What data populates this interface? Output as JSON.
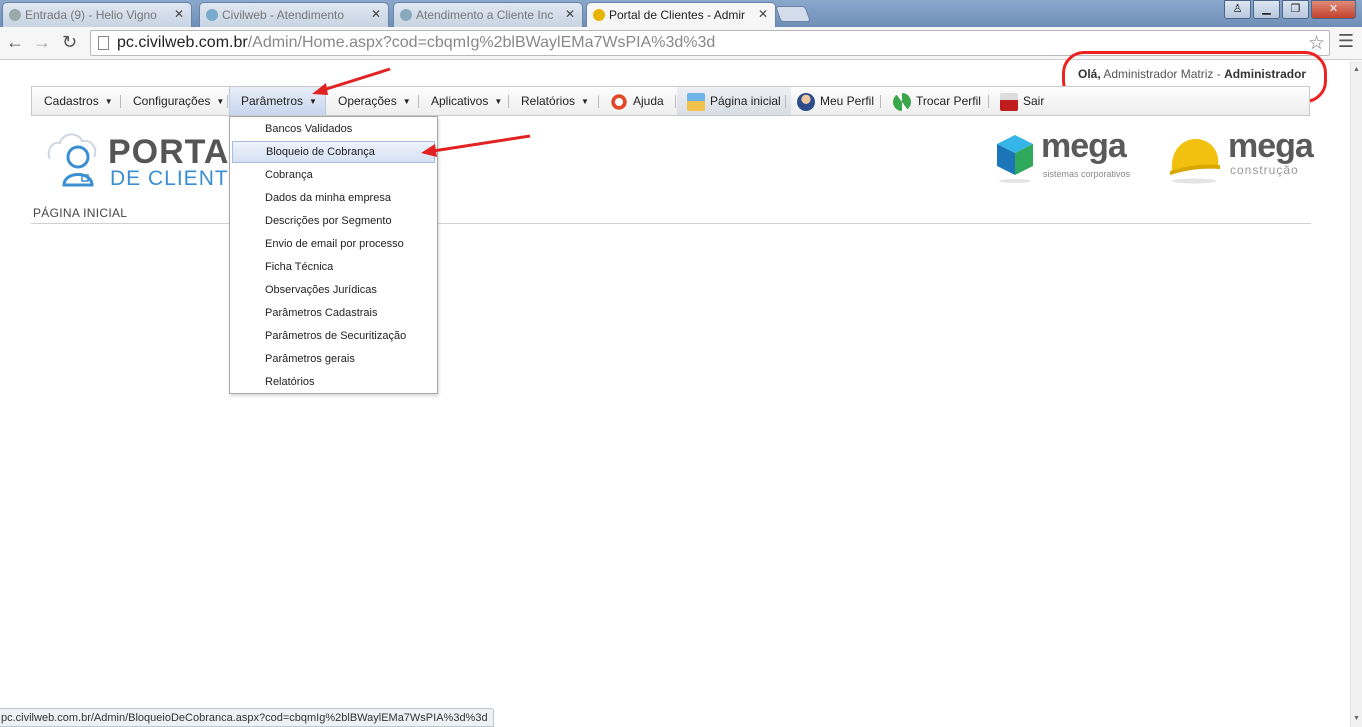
{
  "browser": {
    "tabs": [
      {
        "title": "Entrada (9) - Helio Vigno",
        "active": false,
        "color": "#9aa"
      },
      {
        "title": "Civilweb - Atendimento",
        "active": false,
        "color": "#7ac"
      },
      {
        "title": "Atendimento a Cliente Inc",
        "active": false,
        "color": "#8ab"
      },
      {
        "title": "Portal de Clientes - Admir",
        "active": true,
        "color": "#e8b400"
      }
    ],
    "close_glyph": "✕",
    "url_host": "pc.civilweb.com.br",
    "url_path": "/Admin/Home.aspx?cod=cbqmIg%2blBWaylEMa7WsPIA%3d%3d",
    "status_url": "pc.civilweb.com.br/Admin/BloqueioDeCobranca.aspx?cod=cbqmIg%2blBWaylEMa7WsPIA%3d%3d"
  },
  "header": {
    "greeting_prefix": "Olá,",
    "greeting_user": "Administrador Matriz -",
    "greeting_role": "Administrador"
  },
  "menu": {
    "items": [
      {
        "label": "Cadastros"
      },
      {
        "label": "Configurações"
      },
      {
        "label": "Parâmetros"
      },
      {
        "label": "Operações"
      },
      {
        "label": "Aplicativos"
      },
      {
        "label": "Relatórios"
      }
    ],
    "help": "Ajuda",
    "home": "Página inicial",
    "profile": "Meu Perfil",
    "switch_profile": "Trocar Perfil",
    "logout": "Sair"
  },
  "dropdown": {
    "items": [
      "Bancos Validados",
      "Bloqueio de Cobrança",
      "Cobrança",
      "Dados da minha empresa",
      "Descrições por Segmento",
      "Envio de email por processo",
      "Ficha Técnica",
      "Observações Jurídicas",
      "Parâmetros Cadastrais",
      "Parâmetros de Securitização",
      "Parâmetros gerais",
      "Relatórios"
    ],
    "hover_index": 1
  },
  "logos": {
    "portal_line1": "PORTAL",
    "portal_line2": "DE CLIENTE",
    "mega1_word": "mega",
    "mega1_sub": "sistemas corporativos",
    "mega2_word": "mega",
    "mega2_sub": "construção"
  },
  "page": {
    "heading": "PÁGINA INICIAL"
  },
  "colors": {
    "annotation": "#e22222",
    "portal_blue": "#3a8fd2",
    "menu_active": "#c7d6ee"
  }
}
